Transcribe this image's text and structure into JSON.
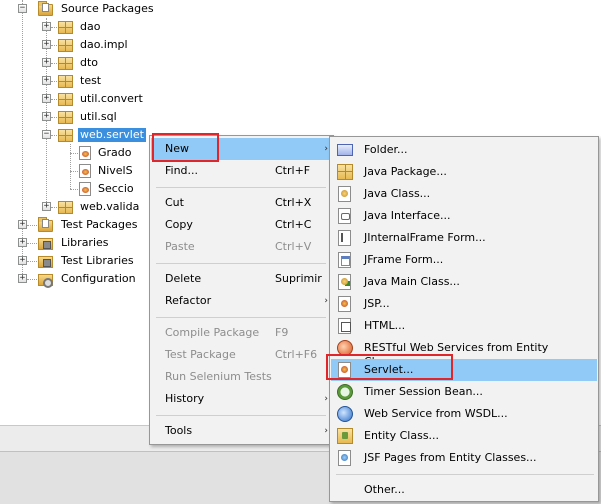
{
  "tree": {
    "nodes": [
      {
        "label": "Source Packages",
        "expander": "−"
      },
      {
        "label": "dao",
        "expander": "+"
      },
      {
        "label": "dao.impl",
        "expander": "+"
      },
      {
        "label": "dto",
        "expander": "+"
      },
      {
        "label": "test",
        "expander": "+"
      },
      {
        "label": "util.convert",
        "expander": "+"
      },
      {
        "label": "util.sql",
        "expander": "+"
      },
      {
        "label": "web.servlet",
        "expander": "−"
      },
      {
        "label": "Grado"
      },
      {
        "label": "NivelS"
      },
      {
        "label": "Seccio"
      },
      {
        "label": "web.valida",
        "expander": "+"
      },
      {
        "label": "Test Packages",
        "expander": "+"
      },
      {
        "label": "Libraries",
        "expander": "+"
      },
      {
        "label": "Test Libraries",
        "expander": "+"
      },
      {
        "label": "Configuration",
        "expander": "+"
      }
    ]
  },
  "context_menu": {
    "items": [
      {
        "label": "New",
        "shortcut": "",
        "arrow": "›"
      },
      {
        "label": "Find...",
        "shortcut": "Ctrl+F"
      },
      {
        "label": "Cut",
        "shortcut": "Ctrl+X"
      },
      {
        "label": "Copy",
        "shortcut": "Ctrl+C"
      },
      {
        "label": "Paste",
        "shortcut": "Ctrl+V"
      },
      {
        "label": "Delete",
        "shortcut": "Suprimir"
      },
      {
        "label": "Refactor",
        "arrow": "›"
      },
      {
        "label": "Compile Package",
        "shortcut": "F9"
      },
      {
        "label": "Test Package",
        "shortcut": "Ctrl+F6"
      },
      {
        "label": "Run Selenium Tests"
      },
      {
        "label": "History",
        "arrow": "›"
      },
      {
        "label": "Tools",
        "arrow": "›"
      }
    ]
  },
  "new_submenu": {
    "items": [
      {
        "label": "Folder...",
        "icon": "folder-icon"
      },
      {
        "label": "Java Package...",
        "icon": "java-package-icon"
      },
      {
        "label": "Java Class...",
        "icon": "java-class-icon"
      },
      {
        "label": "Java Interface...",
        "icon": "java-interface-icon"
      },
      {
        "label": "JInternalFrame Form...",
        "icon": "jinternalframe-icon"
      },
      {
        "label": "JFrame Form...",
        "icon": "jframe-icon"
      },
      {
        "label": "Java Main Class...",
        "icon": "java-main-class-icon"
      },
      {
        "label": "JSP...",
        "icon": "jsp-icon"
      },
      {
        "label": "HTML...",
        "icon": "html-icon"
      },
      {
        "label": "RESTful Web Services from Entity Classes...",
        "icon": "restful-icon"
      },
      {
        "label": "Servlet...",
        "icon": "servlet-icon"
      },
      {
        "label": "Timer Session Bean...",
        "icon": "timer-icon"
      },
      {
        "label": "Web Service from WSDL...",
        "icon": "web-service-icon"
      },
      {
        "label": "Entity Class...",
        "icon": "entity-class-icon"
      },
      {
        "label": "JSF Pages from Entity Classes...",
        "icon": "jsf-icon"
      },
      {
        "label": "Other..."
      }
    ]
  },
  "colors": {
    "highlight": "#91c9f7",
    "selection": "#3a8fde",
    "annotation_red": "#e0262b"
  }
}
